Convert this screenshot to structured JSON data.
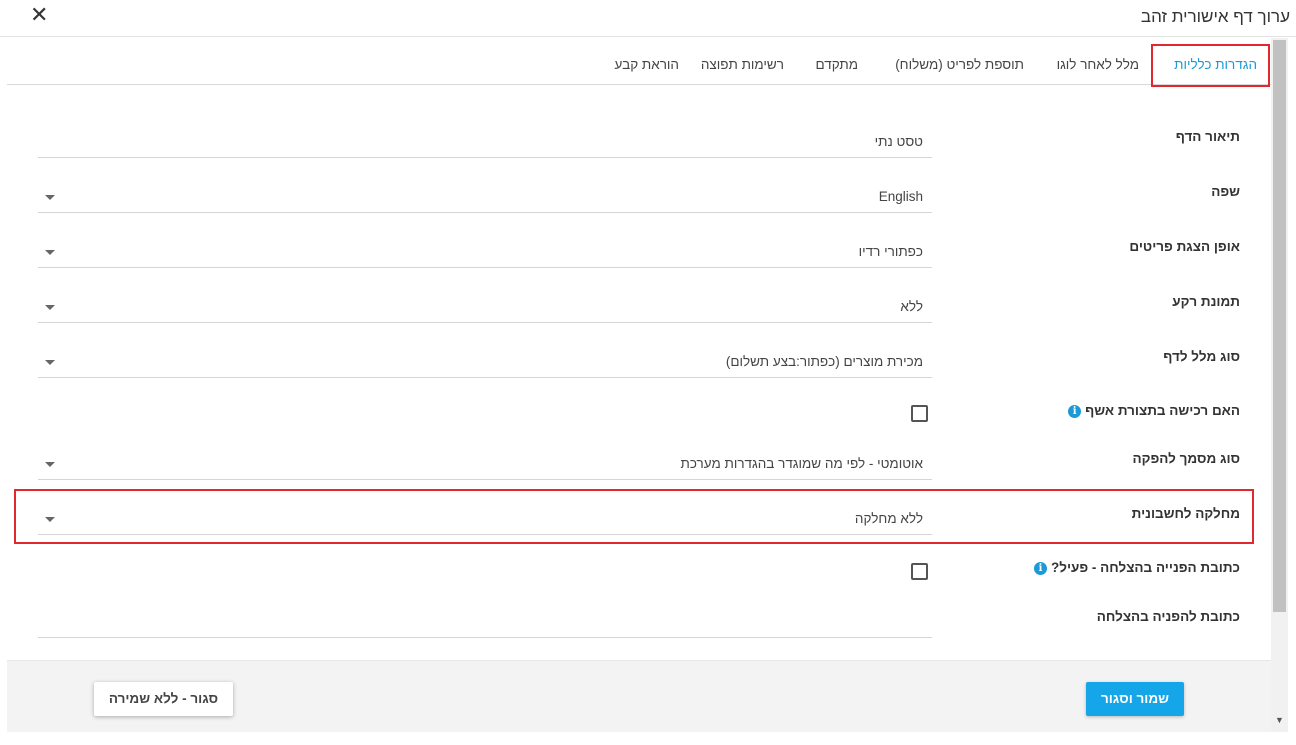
{
  "window": {
    "title": "ערוך דף אישורית זהב",
    "close_icon": "close-icon"
  },
  "tabs": [
    {
      "label": "הגדרות כלליות",
      "active": true
    },
    {
      "label": "מלל לאחר לוגו"
    },
    {
      "label": "תוספת לפריט (משלוח)"
    },
    {
      "label": "מתקדם"
    },
    {
      "label": "רשימות תפוצה"
    },
    {
      "label": "הוראת קבע"
    }
  ],
  "form": {
    "page_description": {
      "label": "תיאור הדף",
      "value": "טסט נתי"
    },
    "language": {
      "label": "שפה",
      "value": "English"
    },
    "items_display": {
      "label": "אופן הצגת פריטים",
      "value": "כפתורי רדיו"
    },
    "background_image": {
      "label": "תמונת רקע",
      "value": "ללא"
    },
    "page_text_type": {
      "label": "סוג מלל לדף",
      "value": "מכירת מוצרים (כפתור:בצע תשלום)"
    },
    "confirm_purchase": {
      "label": "האם רכישה בתצורת אשף",
      "checked": false
    },
    "document_type": {
      "label": "סוג מסמך להפקה",
      "value": "אוטומטי - לפי מה שמוגדר בהגדרות מערכת"
    },
    "accounting_department": {
      "label": "מחלקה לחשבונית",
      "value": "ללא מחלקה"
    },
    "success_redirect_active": {
      "label": "כתובת הפנייה בהצלחה - פעיל?",
      "checked": false
    },
    "success_redirect_url": {
      "label": "כתובת להפניה בהצלחה",
      "value": ""
    }
  },
  "footer": {
    "save_close_label": "שמור וסגור",
    "close_no_save_label": "סגור - ללא שמירה"
  },
  "colors": {
    "accent": "#1c9ad6",
    "primary_button": "#14a6e8",
    "highlight": "#e0282e"
  }
}
